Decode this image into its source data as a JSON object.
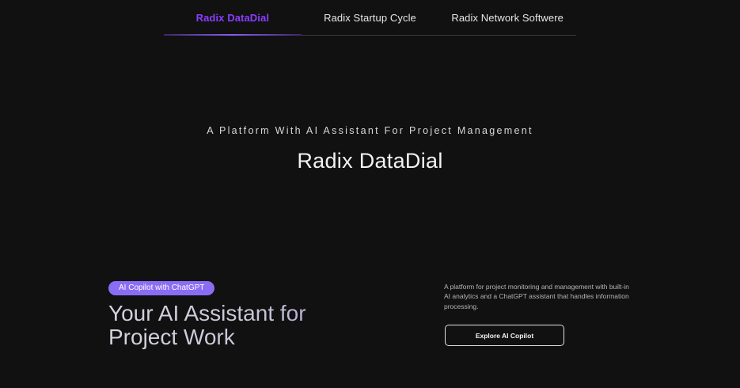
{
  "tabs": [
    {
      "label": "Radix DataDial",
      "active": true
    },
    {
      "label": "Radix Startup Cycle",
      "active": false
    },
    {
      "label": "Radix Network Softwere",
      "active": false
    }
  ],
  "hero": {
    "eyebrow": "A Platform With AI Assistant For Project Management",
    "title": "Radix DataDial"
  },
  "feature": {
    "badge": "AI Copilot with ChatGPT",
    "headline_line1": "Your AI Assistant for",
    "headline_line2": "Project Work",
    "description": "A platform for project monitoring and management with built-in AI analytics and a ChatGPT assistant that handles information processing.",
    "cta_label": "Explore AI Copilot"
  },
  "colors": {
    "background": "#111111",
    "accent": "#8b3dff",
    "badge": "#8b6cf5"
  }
}
